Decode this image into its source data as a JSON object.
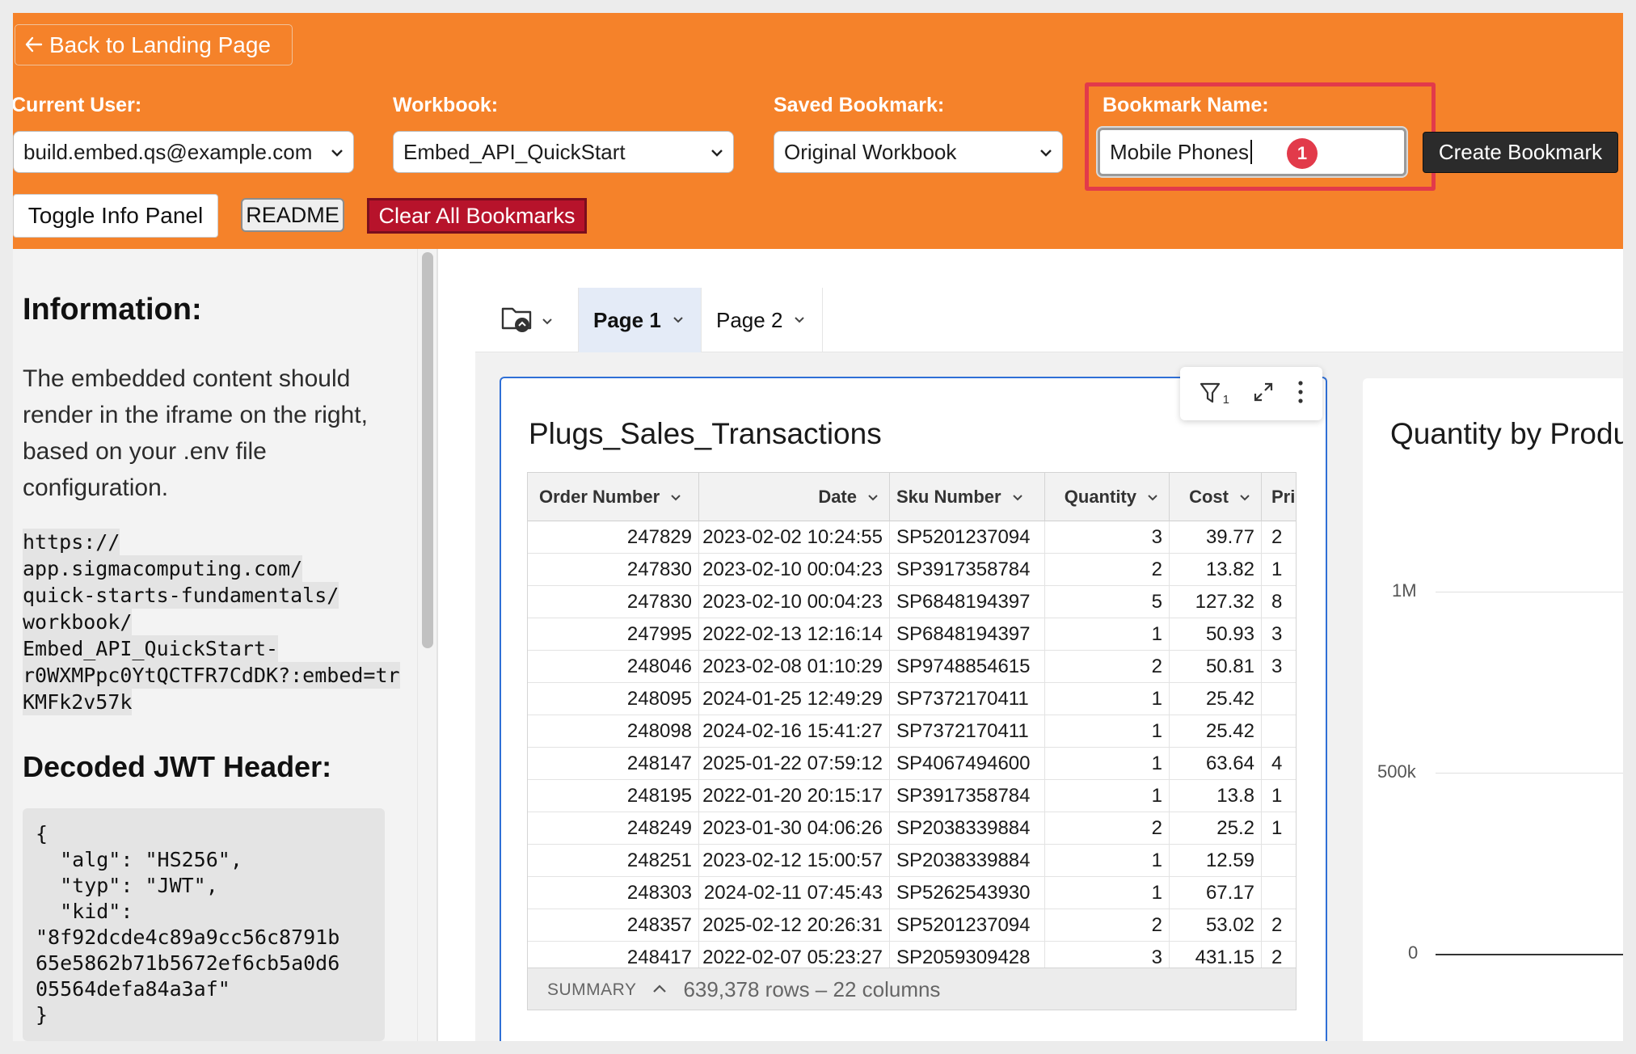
{
  "header": {
    "back_button": "Back to Landing Page",
    "current_user_label": "Current User:",
    "current_user_value": "build.embed.qs@example.com",
    "workbook_label": "Workbook:",
    "workbook_value": "Embed_API_QuickStart",
    "saved_bookmark_label": "Saved Bookmark:",
    "saved_bookmark_value": "Original Workbook",
    "bookmark_name_label": "Bookmark Name:",
    "bookmark_name_value": "Mobile Phones",
    "step_badge": "1",
    "create_bookmark": "Create Bookmark",
    "toggle_info": "Toggle Info Panel",
    "readme": "README",
    "clear_all": "Clear All Bookmarks",
    "colors": {
      "header_bg": "#f5822a",
      "highlight": "#e23a4a",
      "clear_bg": "#b7132b"
    }
  },
  "info": {
    "heading": "Information:",
    "text": "The embedded content should render in the iframe on the right, based on your .env file configuration.",
    "url_lines": [
      "https://",
      "app.sigmacomputing.com/",
      "quick-starts-fundamentals/",
      "workbook/",
      "Embed_API_QuickStart-",
      "r0WXMPpc0YtQCTFR7CdDK?:embed=tr",
      "KMFk2v57k"
    ],
    "jwt_heading": "Decoded JWT Header:",
    "jwt_text": "{\n  \"alg\": \"HS256\",\n  \"typ\": \"JWT\",\n  \"kid\":\n\"8f92dcde4c89a9cc56c8791b\n65e5862b71b5672ef6cb5a0d6\n05564defa84a3af\"\n}"
  },
  "embed": {
    "tabs": [
      {
        "label": "Page 1",
        "active": true
      },
      {
        "label": "Page 2",
        "active": false
      }
    ],
    "filter_count": "1",
    "table_card": {
      "title": "Plugs_Sales_Transactions",
      "columns": [
        "Order Number",
        "Date",
        "Sku Number",
        "Quantity",
        "Cost",
        "Pri"
      ],
      "rows": [
        [
          "247829",
          "2023-02-02 10:24:55",
          "SP5201237094",
          "3",
          "39.77",
          "2"
        ],
        [
          "247830",
          "2023-02-10 00:04:23",
          "SP3917358784",
          "2",
          "13.82",
          "1"
        ],
        [
          "247830",
          "2023-02-10 00:04:23",
          "SP6848194397",
          "5",
          "127.32",
          "8"
        ],
        [
          "247995",
          "2022-02-13 12:16:14",
          "SP6848194397",
          "1",
          "50.93",
          "3"
        ],
        [
          "248046",
          "2023-02-08 01:10:29",
          "SP9748854615",
          "2",
          "50.81",
          "3"
        ],
        [
          "248095",
          "2024-01-25 12:49:29",
          "SP7372170411",
          "1",
          "25.42",
          ""
        ],
        [
          "248098",
          "2024-02-16 15:41:27",
          "SP7372170411",
          "1",
          "25.42",
          ""
        ],
        [
          "248147",
          "2025-01-22 07:59:12",
          "SP4067494600",
          "1",
          "63.64",
          "4"
        ],
        [
          "248195",
          "2022-01-20 20:15:17",
          "SP3917358784",
          "1",
          "13.8",
          "1"
        ],
        [
          "248249",
          "2023-01-30 04:06:26",
          "SP2038339884",
          "2",
          "25.2",
          "1"
        ],
        [
          "248251",
          "2023-02-12 15:00:57",
          "SP2038339884",
          "1",
          "12.59",
          ""
        ],
        [
          "248303",
          "2024-02-11 07:45:43",
          "SP5262543930",
          "1",
          "67.17",
          ""
        ],
        [
          "248357",
          "2025-02-12 20:26:31",
          "SP5201237094",
          "2",
          "53.02",
          "2"
        ],
        [
          "248417",
          "2022-02-07 05:23:27",
          "SP2059309428",
          "3",
          "431.15",
          "2"
        ]
      ],
      "summary_label": "SUMMARY",
      "summary_text": "639,378 rows – 22 columns"
    },
    "chart_card": {
      "title": "Quantity by Produ",
      "y_ticks": [
        "1M",
        "500k",
        "0"
      ]
    }
  }
}
